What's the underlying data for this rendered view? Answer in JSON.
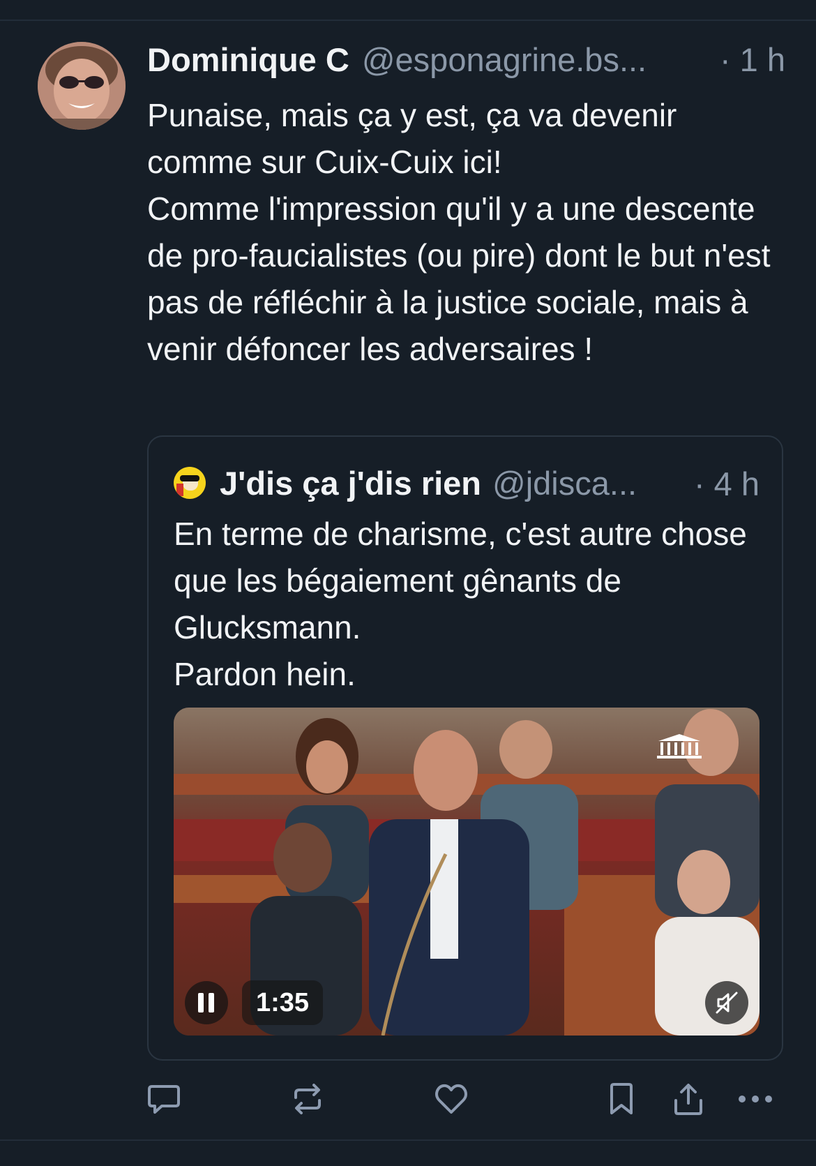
{
  "post": {
    "author_name": "Dominique C",
    "author_handle": "@esponagrine.bs...",
    "time": "· 1 h",
    "text": "Punaise, mais ça y est, ça va devenir comme sur Cuix-Cuix ici!\nComme l'impression qu'il y a une descente de pro-faucialistes (ou pire) dont le but n'est pas de réfléchir à la justice sociale, mais à venir défoncer les adversaires !",
    "avatar_icon": "user-avatar"
  },
  "quote": {
    "author_name": "J'dis ça j'dis rien",
    "author_handle": "@jdisca...",
    "time": "· 4 h",
    "text": "En terme de charisme, c'est autre chose que les bégaiement gênants de Glucksmann.\nPardon hein.",
    "video": {
      "duration": "1:35",
      "state": "playing",
      "muted": true
    }
  },
  "actions": {
    "icons": [
      "reply-icon",
      "repost-icon",
      "like-icon",
      "bookmark-icon",
      "share-icon",
      "more-icon"
    ]
  },
  "colors": {
    "background": "#161e27",
    "text": "#f1f3f5",
    "muted_text": "#8b98a8",
    "border": "#2a3541",
    "icon": "#8d9bb0"
  }
}
